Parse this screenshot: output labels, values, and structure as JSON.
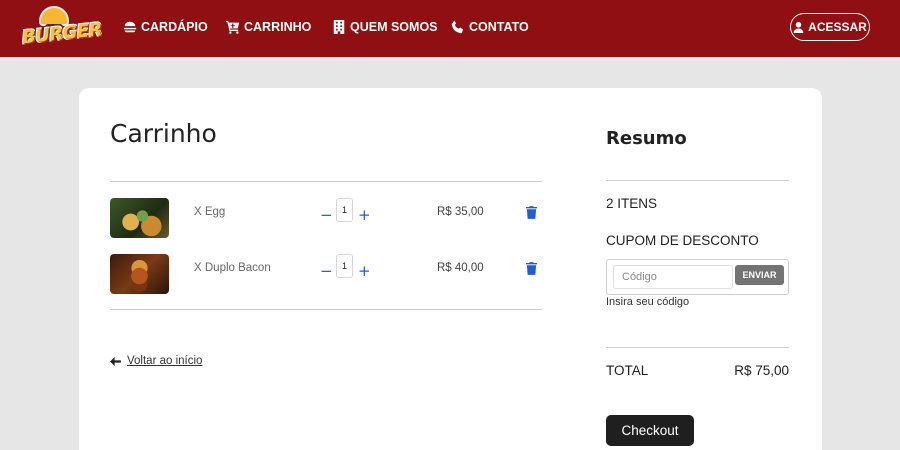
{
  "brand": {
    "logo_text": "BURGER",
    "accent_color": "#8f0f12"
  },
  "nav": {
    "items": [
      {
        "label": "CARDÁPIO",
        "icon": "burger-icon"
      },
      {
        "label": "CARRINHO",
        "icon": "cart-icon"
      },
      {
        "label": "QUEM SOMOS",
        "icon": "building-icon"
      },
      {
        "label": "CONTATO",
        "icon": "phone-icon"
      }
    ],
    "login_label": "ACESSAR",
    "login_icon": "user-icon"
  },
  "cart": {
    "title": "Carrinho",
    "items": [
      {
        "name": "X Egg",
        "quantity": "1",
        "price": "R$ 35,00",
        "image_icon": "x-egg-burger-image"
      },
      {
        "name": "X Duplo Bacon",
        "quantity": "1",
        "price": "R$ 40,00",
        "image_icon": "x-duplo-bacon-burger-image"
      }
    ],
    "minus_label": "−",
    "plus_label": "+",
    "back_label": "Voltar ao início"
  },
  "summary": {
    "title": "Resumo",
    "items_count": "2 ITENS",
    "coupon_label": "CUPOM DE DESCONTO",
    "coupon_placeholder": "Código",
    "coupon_button": "ENVIAR",
    "coupon_hint": "Insira seu código",
    "total_label": "TOTAL",
    "total_value": "R$ 75,00",
    "checkout_label": "Checkout"
  }
}
